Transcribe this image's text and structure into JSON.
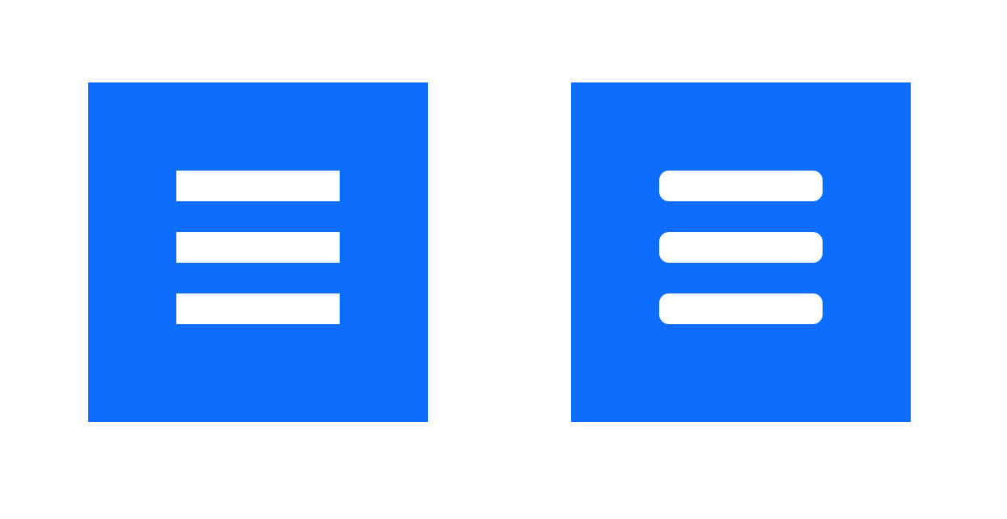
{
  "colors": {
    "background": "#ffffff",
    "button_fill": "#0d6efd",
    "bar_fill": "#ffffff"
  },
  "buttons": [
    {
      "icon": "hamburger-menu-icon",
      "bar_style": "square"
    },
    {
      "icon": "hamburger-menu-icon",
      "bar_style": "rounded"
    }
  ]
}
